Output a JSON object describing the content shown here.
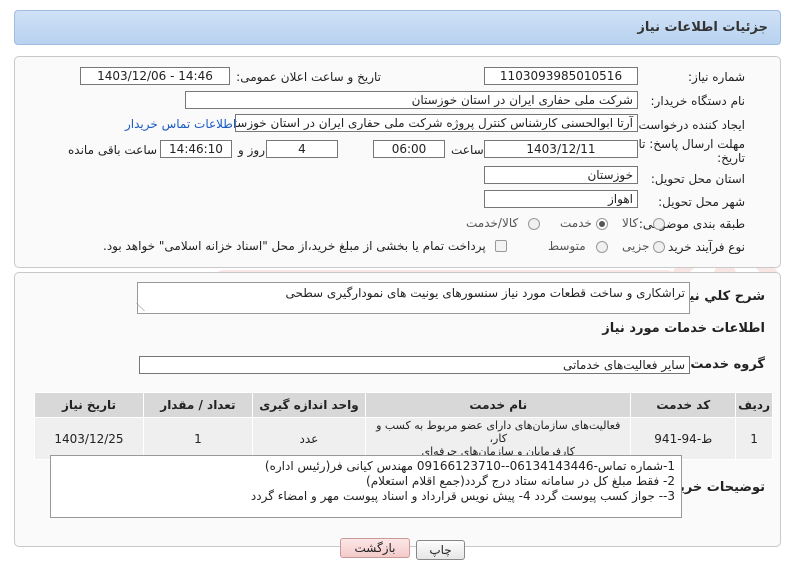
{
  "header": {
    "title": "جزئیات اطلاعات نیاز"
  },
  "form": {
    "need_number_label": "شماره نیاز:",
    "need_number": "1103093985010516",
    "announce_label": "تاریخ و ساعت اعلان عمومی:",
    "announce_value": "1403/12/06 - 14:46",
    "buyer_label": "نام دستگاه خریدار:",
    "buyer_value": "شرکت ملی حفاری ایران در استان خوزستان",
    "creator_label": "ایجاد کننده درخواست:",
    "creator_value": "آرتا ابوالحسنی کارشناس کنترل پروژه شرکت ملی حفاری ایران در استان خوزستان",
    "contact_link": "اطلاعات تماس خریدار",
    "deadline_label_1": "مهلت ارسال پاسخ: تا",
    "deadline_label_2": "تاریخ:",
    "deadline_date": "1403/12/11",
    "time_label": "ساعت",
    "deadline_time": "06:00",
    "days_value": "4",
    "days_label": "روز و",
    "remaining_time": "14:46:10",
    "remaining_label": "ساعت باقی مانده",
    "province_label": "استان محل تحویل:",
    "province_value": "خوزستان",
    "city_label": "شهر محل تحویل:",
    "city_value": "اهواز",
    "category_label": "طبقه بندی موضوعی:",
    "category_options": [
      "کالا",
      "خدمت",
      "کالا/خدمت"
    ],
    "category_selected": "خدمت",
    "process_label": "نوع فرآیند خرید :",
    "process_options": [
      "جزیی",
      "متوسط"
    ],
    "process_selected": "",
    "payment_note": "پرداخت تمام یا بخشی از مبلغ خرید،از محل \"اسناد خزانه اسلامی\" خواهد بود."
  },
  "summary": {
    "label": "شرح کلي نياز:",
    "value": "تراشکاری و ساخت قطعات مورد نیاز سنسورهای یونیت های نمودارگیری سطحی"
  },
  "services": {
    "section_title": "اطلاعات خدمات مورد نیاز",
    "group_label": "گروه خدمت:",
    "group_value": "سایر فعالیت‌های خدماتی",
    "columns": [
      "ردیف",
      "کد خدمت",
      "نام خدمت",
      "واحد اندازه گیری",
      "تعداد / مقدار",
      "تاریخ نیاز"
    ],
    "rows": [
      {
        "index": "1",
        "code": "ط-94-941",
        "name_line1": "فعالیت‌های سازمان‌های دارای عضو مربوط به کسب و کار،",
        "name_line2": "کارفرمایان و سازمان‌های حرفه‌ای",
        "unit": "عدد",
        "qty": "1",
        "date": "1403/12/25"
      }
    ]
  },
  "buyer_notes": {
    "label": "توضیحات خریدار:",
    "line1": "1-شماره تماس-06134143446--09166123710 مهندس کیانی فر(رئیس اداره)",
    "line2": "2- فقط مبلغ کل در سامانه ستاد درج گردد(جمع اقلام استعلام)",
    "line3": "3-- جواز کسب  پیوست گردد 4- پیش نویس قرارداد و اسناد پیوست مهر و امضاء گردد"
  },
  "buttons": {
    "print": "چاپ",
    "back": "بازگشت"
  },
  "colors": {
    "header_bg": "#c5dbf3",
    "link": "#1a5bc4",
    "watermark": "#c0392b"
  }
}
